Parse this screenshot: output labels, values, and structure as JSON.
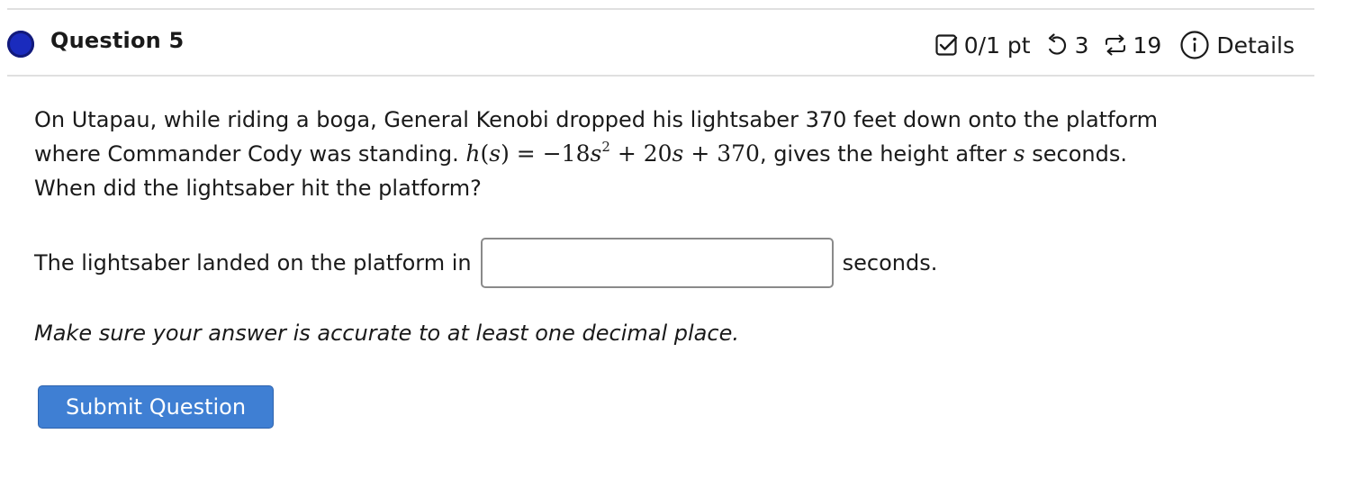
{
  "header": {
    "question_title": "Question 5",
    "score": "0/1 pt",
    "retries": "3",
    "attempts": "19",
    "details_label": "Details"
  },
  "question": {
    "line1": "On Utapau, while riding a boga, General Kenobi dropped his lightsaber 370 feet down onto the platform",
    "line2_start": "where Commander Cody was standing.",
    "formula": {
      "lhs_fn": "h",
      "lhs_var": "s",
      "coef_a": "−18",
      "var": "s",
      "exp": "2",
      "coef_b": "20",
      "const": "370"
    },
    "line2_end_a": ", gives the height after",
    "line2_end_var": "s",
    "line2_end_b": "seconds.",
    "line3": "When did the lightsaber hit the platform?"
  },
  "answer": {
    "prefix": "The lightsaber landed on the platform in",
    "value": "",
    "placeholder": "",
    "suffix": "seconds."
  },
  "note": "Make sure your answer is accurate to at least one decimal place.",
  "submit_label": "Submit Question",
  "icons": {
    "status": "status-dot-icon",
    "score": "checkbox-icon",
    "retries": "undo-icon",
    "attempts": "repeat-icon",
    "details": "info-icon"
  },
  "colors": {
    "status_dot": "#1a2bbd",
    "button": "#3f7fd3"
  }
}
